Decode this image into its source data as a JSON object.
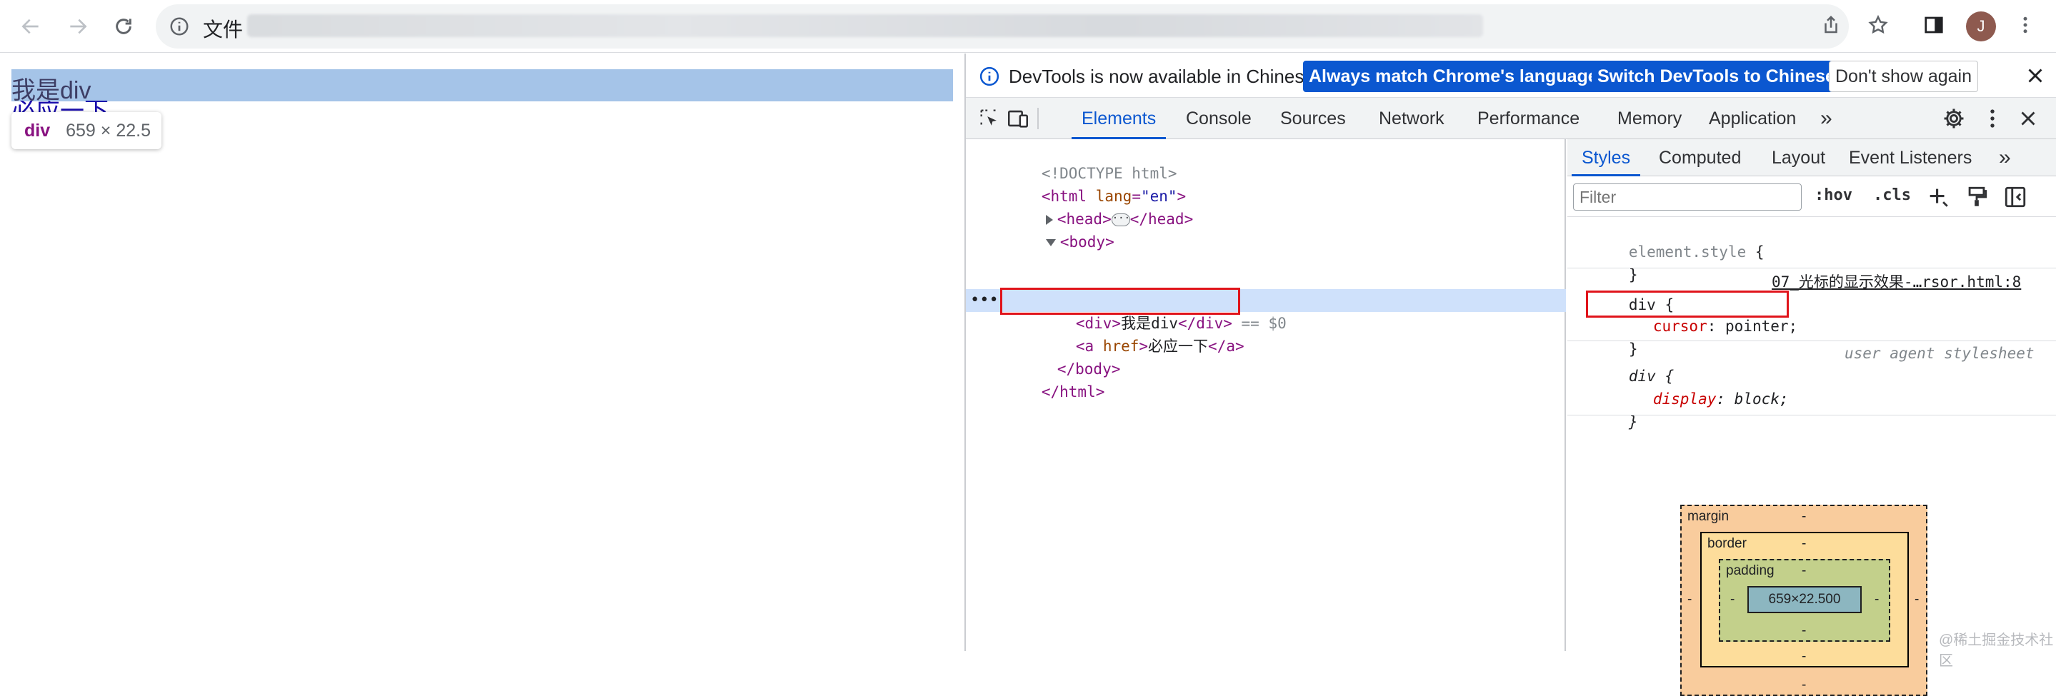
{
  "browser": {
    "omnibox_label": "文件",
    "avatar_letter": "J"
  },
  "page": {
    "div_text": "我是div",
    "link_text": "必应一下",
    "tooltip_tag": "div",
    "tooltip_size": "659 × 22.5"
  },
  "devtools": {
    "infobar": {
      "message": "DevTools is now available in Chinese!",
      "btn_match": "Always match Chrome's language",
      "btn_switch": "Switch DevTools to Chinese",
      "btn_dismiss": "Don't show again"
    },
    "tabs": [
      "Elements",
      "Console",
      "Sources",
      "Network",
      "Performance",
      "Memory",
      "Application"
    ],
    "more_tabs": "»",
    "dom": {
      "doctype": "<!DOCTYPE html>",
      "html_open_tag": "<html",
      "html_attr": "lang",
      "html_attr_val": "\"en\"",
      "head_open": "<head>",
      "head_close": "</head>",
      "body_open": "<body>",
      "div_open": "<div>",
      "div_text": "我是div",
      "div_close": "</div>",
      "selected_marker": "== $0",
      "a_open": "<a",
      "a_attr": "href",
      "a_text": "必应一下",
      "a_close": "</a>",
      "body_close": "</body>",
      "html_close": "</html>",
      "dots": "•••"
    },
    "styles": {
      "tabs": [
        "Styles",
        "Computed",
        "Layout",
        "Event Listeners"
      ],
      "more_tabs": "»",
      "filter_placeholder": "Filter",
      "hov": ":hov",
      "cls": ".cls",
      "element_style_selector": "element.style",
      "rule1_selector": "div",
      "rule1_source": "07_光标的显示效果-…rsor.html:8",
      "rule1_prop": "cursor",
      "rule1_value": "pointer;",
      "rule2_selector": "div",
      "rule2_source": "user agent stylesheet",
      "rule2_prop": "display",
      "rule2_value": "block;",
      "open_brace": "{",
      "close_brace": "}"
    },
    "box_model": {
      "margin_label": "margin",
      "border_label": "border",
      "padding_label": "padding",
      "content": "659×22.500",
      "dash": "-"
    }
  },
  "watermark": "@稀土掘金技术社区",
  "colors": {
    "accent": "#0b57d0",
    "highlight_red": "#e0141b",
    "selection_bg": "#cfe1fb"
  }
}
